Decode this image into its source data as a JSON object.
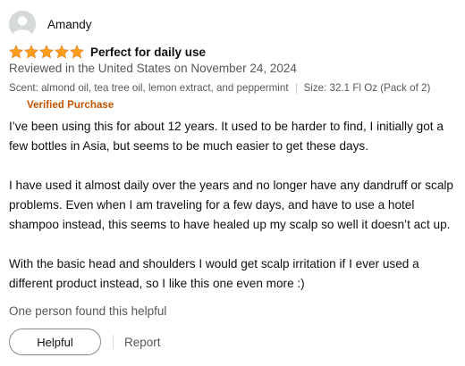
{
  "reviewer": {
    "name": "Amandy",
    "avatar_icon": "user-silhouette-icon"
  },
  "rating": {
    "stars": 5,
    "max_stars": 5,
    "star_color": "#ff9f1a",
    "star_icon": "star-icon"
  },
  "review": {
    "title": "Perfect for daily use",
    "date_line": "Reviewed in the United States on November 24, 2024",
    "scent": "Scent: almond oil, tea tree oil, lemon extract, and peppermint",
    "size": "Size: 32.1 Fl Oz (Pack of 2)",
    "verified_label": "Verified Purchase",
    "verified_color": "#c45500",
    "paragraphs": [
      "I’ve been using this for about 12 years. It used to be harder to find, I initially got a few bottles in Asia, but seems to be much easier to get these days.",
      "I have used it almost daily over the years and no longer have any dandruff or scalp problems. Even when I am traveling for a few days, and have to use a hotel shampoo instead, this seems to have healed up my scalp so well it doesn’t act up.",
      "With the basic head and shoulders I would get scalp irritation if I ever used a different product instead, so I like this one even more :)"
    ]
  },
  "helpful_count_text": "One person found this helpful",
  "actions": {
    "helpful_label": "Helpful",
    "report_label": "Report"
  }
}
